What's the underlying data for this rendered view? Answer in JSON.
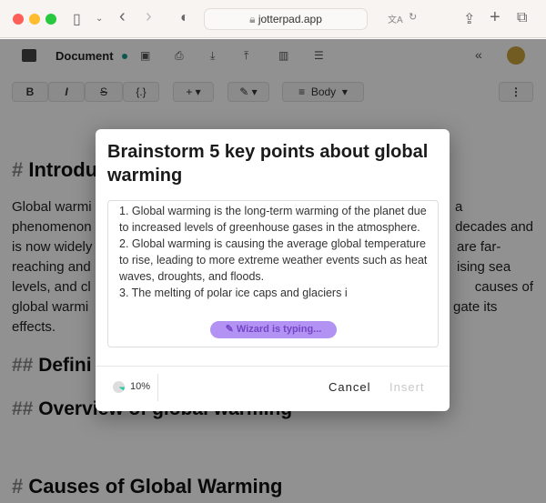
{
  "browser": {
    "url": "jotterpad.app"
  },
  "toolbar": {
    "doc_title": "Document",
    "status_color": "#1a9a8a"
  },
  "format": {
    "bold": "B",
    "italic": "I",
    "strike": "S",
    "code": "{.}",
    "insert": "+",
    "style": "Body",
    "more": "⋮"
  },
  "document": {
    "h1": "Introdu",
    "lines_left": [
      "Global warmi",
      "phenomenon",
      "is now widely",
      "reaching and",
      "levels, and cl",
      "global warmi",
      "effects."
    ],
    "lines_right": [
      "a",
      "decades and",
      "are far-",
      "ising sea",
      "causes of",
      "gate its",
      ""
    ],
    "h2a": "Defini",
    "h2b": "Overview of global warming",
    "h1b": "Causes of Global Warming"
  },
  "modal": {
    "title": "Brainstorm 5 key points about global warming",
    "generated_text": "1. Global warming is the long-term warming of the planet due to increased levels of greenhouse gases in the atmosphere.\n2. Global warming is causing the average global temperature to rise, leading to more extreme weather events such as heat waves, droughts, and floods.\n3. The melting of polar ice caps and glaciers i",
    "typing": "Wizard is typing...",
    "progress_label": "10%",
    "progress": 0.1,
    "cancel": "Cancel",
    "insert": "Insert",
    "accent": "#b292f2"
  }
}
